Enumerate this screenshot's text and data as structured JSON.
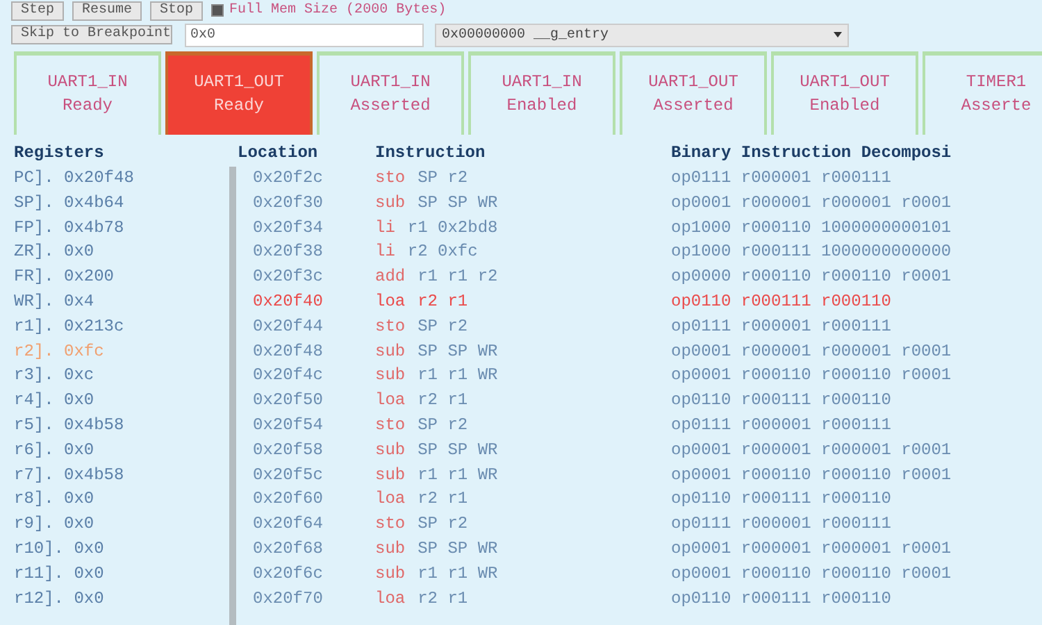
{
  "toolbar": {
    "buttons": [
      "Step",
      "Resume",
      "Stop"
    ],
    "checkbox": {
      "label": "Full Mem Size (2000 Bytes)",
      "checked": true
    },
    "skip_button": "Skip to Breakpoint",
    "address_field": {
      "value": "0x0"
    },
    "symbol_select": {
      "value": "0x00000000 __g_entry"
    }
  },
  "tabs": [
    {
      "title": "UART1_IN",
      "status": "Ready",
      "selected": false
    },
    {
      "title": "UART1_OUT",
      "status": "Ready",
      "selected": true
    },
    {
      "title": "UART1_IN",
      "status": "Asserted",
      "selected": false
    },
    {
      "title": "UART1_IN",
      "status": "Enabled",
      "selected": false
    },
    {
      "title": "UART1_OUT",
      "status": "Asserted",
      "selected": false
    },
    {
      "title": "UART1_OUT",
      "status": "Enabled",
      "selected": false
    },
    {
      "title": "TIMER1",
      "status": "Asserte",
      "selected": false
    }
  ],
  "registers": {
    "heading": "Registers",
    "rows": [
      {
        "text": "PC]. 0x20f48",
        "changed": false
      },
      {
        "text": "SP]. 0x4b64",
        "changed": false
      },
      {
        "text": "FP]. 0x4b78",
        "changed": false
      },
      {
        "text": "ZR]. 0x0",
        "changed": false
      },
      {
        "text": "FR]. 0x200",
        "changed": false
      },
      {
        "text": "WR]. 0x4",
        "changed": false
      },
      {
        "text": "r1]. 0x213c",
        "changed": false
      },
      {
        "text": "r2]. 0xfc",
        "changed": true
      },
      {
        "text": "r3]. 0xc",
        "changed": false
      },
      {
        "text": "r4]. 0x0",
        "changed": false
      },
      {
        "text": "r5]. 0x4b58",
        "changed": false
      },
      {
        "text": "r6]. 0x0",
        "changed": false
      },
      {
        "text": "r7]. 0x4b58",
        "changed": false
      },
      {
        "text": "r8]. 0x0",
        "changed": false
      },
      {
        "text": "r9]. 0x0",
        "changed": false
      },
      {
        "text": "r10]. 0x0",
        "changed": false
      },
      {
        "text": "r11]. 0x0",
        "changed": false
      },
      {
        "text": "r12]. 0x0",
        "changed": false
      }
    ]
  },
  "code": {
    "columns": [
      "Location",
      "Instruction",
      "Binary Instruction Decomposi"
    ],
    "rows": [
      {
        "location": "0x20f2c",
        "mnemonic": "sto",
        "operands": "SP r2",
        "binary": "op0111 r000001 r000111",
        "current": false
      },
      {
        "location": "0x20f30",
        "mnemonic": "sub",
        "operands": "SP SP WR",
        "binary": "op0001 r000001 r000001 r0001",
        "current": false
      },
      {
        "location": "0x20f34",
        "mnemonic": "li",
        "operands": "r1 0x2bd8",
        "binary": "op1000 r000110 1000000000101",
        "current": false
      },
      {
        "location": "0x20f38",
        "mnemonic": "li",
        "operands": "r2 0xfc",
        "binary": "op1000 r000111 1000000000000",
        "current": false
      },
      {
        "location": "0x20f3c",
        "mnemonic": "add",
        "operands": "r1 r1 r2",
        "binary": "op0000 r000110 r000110 r0001",
        "current": false
      },
      {
        "location": "0x20f40",
        "mnemonic": "loa",
        "operands": "r2 r1",
        "binary": "op0110 r000111 r000110",
        "current": true
      },
      {
        "location": "0x20f44",
        "mnemonic": "sto",
        "operands": "SP r2",
        "binary": "op0111 r000001 r000111",
        "current": false
      },
      {
        "location": "0x20f48",
        "mnemonic": "sub",
        "operands": "SP SP WR",
        "binary": "op0001 r000001 r000001 r0001",
        "current": false
      },
      {
        "location": "0x20f4c",
        "mnemonic": "sub",
        "operands": "r1 r1 WR",
        "binary": "op0001 r000110 r000110 r0001",
        "current": false
      },
      {
        "location": "0x20f50",
        "mnemonic": "loa",
        "operands": "r2 r1",
        "binary": "op0110 r000111 r000110",
        "current": false
      },
      {
        "location": "0x20f54",
        "mnemonic": "sto",
        "operands": "SP r2",
        "binary": "op0111 r000001 r000111",
        "current": false
      },
      {
        "location": "0x20f58",
        "mnemonic": "sub",
        "operands": "SP SP WR",
        "binary": "op0001 r000001 r000001 r0001",
        "current": false
      },
      {
        "location": "0x20f5c",
        "mnemonic": "sub",
        "operands": "r1 r1 WR",
        "binary": "op0001 r000110 r000110 r0001",
        "current": false
      },
      {
        "location": "0x20f60",
        "mnemonic": "loa",
        "operands": "r2 r1",
        "binary": "op0110 r000111 r000110",
        "current": false
      },
      {
        "location": "0x20f64",
        "mnemonic": "sto",
        "operands": "SP r2",
        "binary": "op0111 r000001 r000111",
        "current": false
      },
      {
        "location": "0x20f68",
        "mnemonic": "sub",
        "operands": "SP SP WR",
        "binary": "op0001 r000001 r000001 r0001",
        "current": false
      },
      {
        "location": "0x20f6c",
        "mnemonic": "sub",
        "operands": "r1 r1 WR",
        "binary": "op0001 r000110 r000110 r0001",
        "current": false
      },
      {
        "location": "0x20f70",
        "mnemonic": "loa",
        "operands": "r2 r1",
        "binary": "op0110 r000111 r000110",
        "current": false
      }
    ]
  }
}
